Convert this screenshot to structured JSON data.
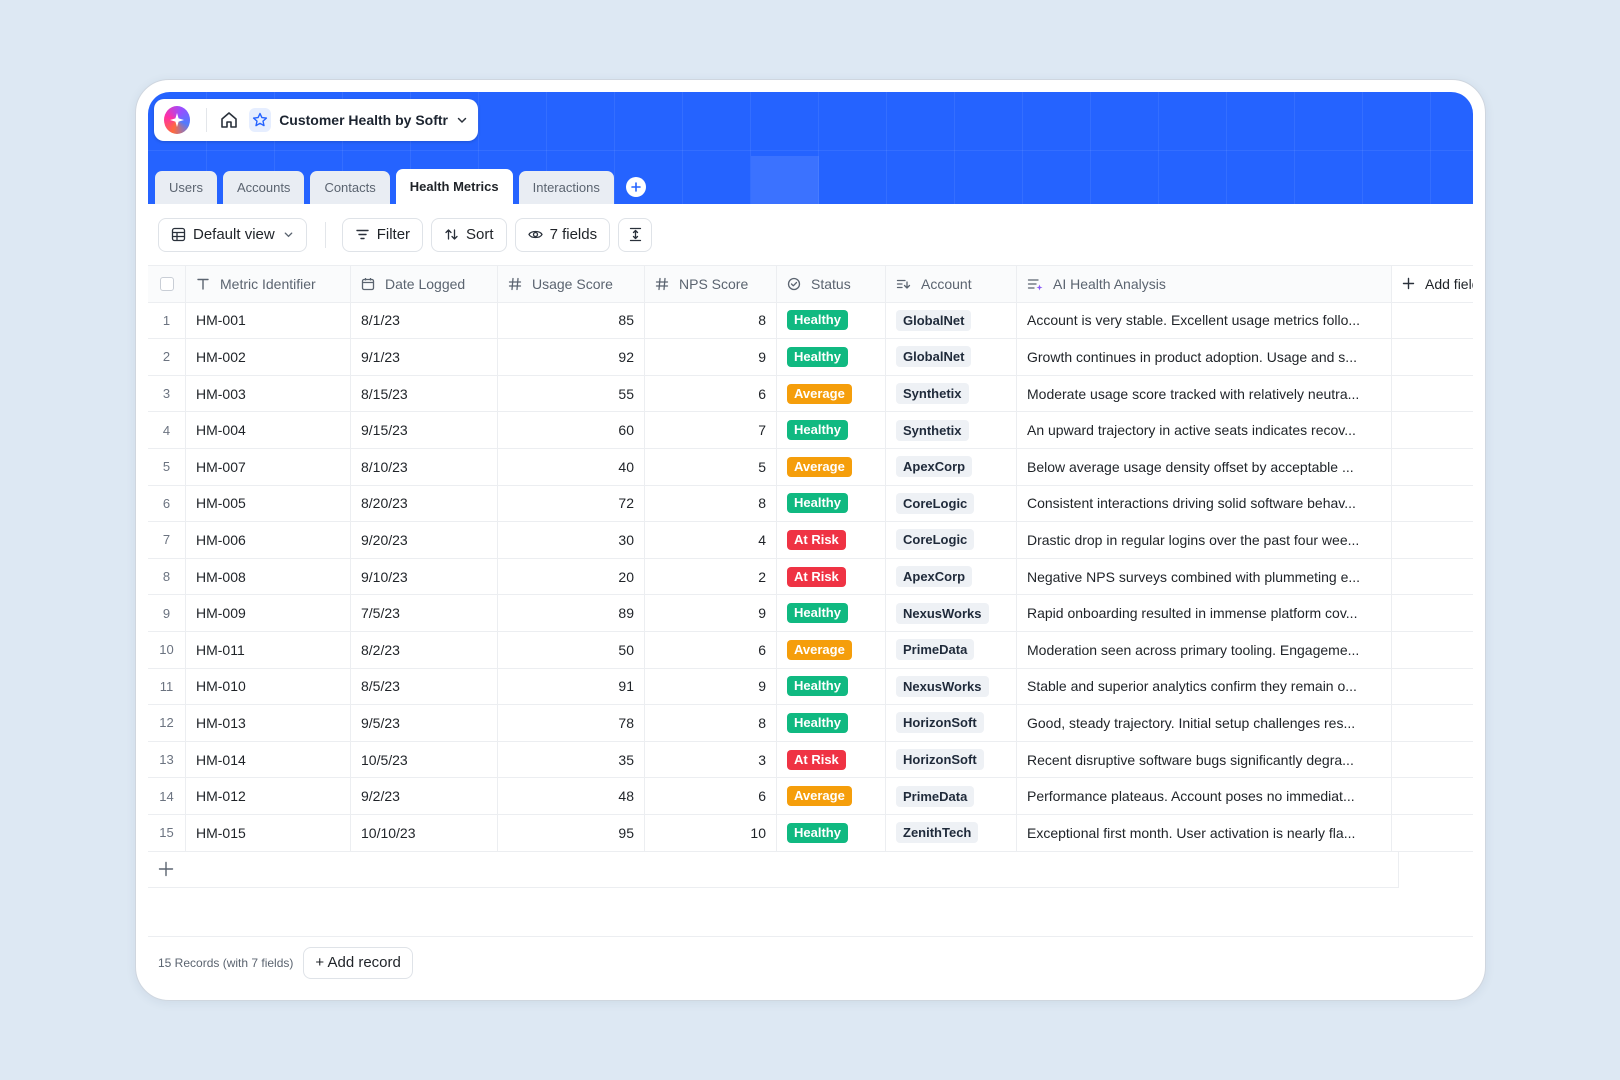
{
  "app": {
    "title": "Customer Health by Softr"
  },
  "tabs": [
    {
      "label": "Users",
      "active": false
    },
    {
      "label": "Accounts",
      "active": false
    },
    {
      "label": "Contacts",
      "active": false
    },
    {
      "label": "Health Metrics",
      "active": true
    },
    {
      "label": "Interactions",
      "active": false
    }
  ],
  "toolbar": {
    "view_label": "Default view",
    "filter_label": "Filter",
    "sort_label": "Sort",
    "fields_label": "7 fields"
  },
  "columns": {
    "metric": "Metric Identifier",
    "date": "Date Logged",
    "usage": "Usage Score",
    "nps": "NPS Score",
    "status": "Status",
    "account": "Account",
    "analysis": "AI Health Analysis",
    "add_field": "Add field"
  },
  "status_colors": {
    "Healthy": "#10b981",
    "Average": "#f59e0b",
    "At Risk": "#ef3344"
  },
  "rows": [
    {
      "n": "1",
      "id": "HM-001",
      "date": "8/1/23",
      "usage": "85",
      "nps": "8",
      "status": "Healthy",
      "account": "GlobalNet",
      "analysis": "Account is very stable. Excellent usage metrics follo..."
    },
    {
      "n": "2",
      "id": "HM-002",
      "date": "9/1/23",
      "usage": "92",
      "nps": "9",
      "status": "Healthy",
      "account": "GlobalNet",
      "analysis": "Growth continues in product adoption. Usage and s..."
    },
    {
      "n": "3",
      "id": "HM-003",
      "date": "8/15/23",
      "usage": "55",
      "nps": "6",
      "status": "Average",
      "account": "Synthetix",
      "analysis": "Moderate usage score tracked with relatively neutra..."
    },
    {
      "n": "4",
      "id": "HM-004",
      "date": "9/15/23",
      "usage": "60",
      "nps": "7",
      "status": "Healthy",
      "account": "Synthetix",
      "analysis": "An upward trajectory in active seats indicates recov..."
    },
    {
      "n": "5",
      "id": "HM-007",
      "date": "8/10/23",
      "usage": "40",
      "nps": "5",
      "status": "Average",
      "account": "ApexCorp",
      "analysis": "Below average usage density offset by acceptable ..."
    },
    {
      "n": "6",
      "id": "HM-005",
      "date": "8/20/23",
      "usage": "72",
      "nps": "8",
      "status": "Healthy",
      "account": "CoreLogic",
      "analysis": "Consistent interactions driving solid software behav..."
    },
    {
      "n": "7",
      "id": "HM-006",
      "date": "9/20/23",
      "usage": "30",
      "nps": "4",
      "status": "At Risk",
      "account": "CoreLogic",
      "analysis": "Drastic drop in regular logins over the past four wee..."
    },
    {
      "n": "8",
      "id": "HM-008",
      "date": "9/10/23",
      "usage": "20",
      "nps": "2",
      "status": "At Risk",
      "account": "ApexCorp",
      "analysis": "Negative NPS surveys combined with plummeting e..."
    },
    {
      "n": "9",
      "id": "HM-009",
      "date": "7/5/23",
      "usage": "89",
      "nps": "9",
      "status": "Healthy",
      "account": "NexusWorks",
      "analysis": "Rapid onboarding resulted in immense platform cov..."
    },
    {
      "n": "10",
      "id": "HM-011",
      "date": "8/2/23",
      "usage": "50",
      "nps": "6",
      "status": "Average",
      "account": "PrimeData",
      "analysis": "Moderation seen across primary tooling. Engageme..."
    },
    {
      "n": "11",
      "id": "HM-010",
      "date": "8/5/23",
      "usage": "91",
      "nps": "9",
      "status": "Healthy",
      "account": "NexusWorks",
      "analysis": "Stable and superior analytics confirm they remain o..."
    },
    {
      "n": "12",
      "id": "HM-013",
      "date": "9/5/23",
      "usage": "78",
      "nps": "8",
      "status": "Healthy",
      "account": "HorizonSoft",
      "analysis": "Good, steady trajectory. Initial setup challenges res..."
    },
    {
      "n": "13",
      "id": "HM-014",
      "date": "10/5/23",
      "usage": "35",
      "nps": "3",
      "status": "At Risk",
      "account": "HorizonSoft",
      "analysis": "Recent disruptive software bugs significantly degra..."
    },
    {
      "n": "14",
      "id": "HM-012",
      "date": "9/2/23",
      "usage": "48",
      "nps": "6",
      "status": "Average",
      "account": "PrimeData",
      "analysis": "Performance plateaus. Account poses no immediat..."
    },
    {
      "n": "15",
      "id": "HM-015",
      "date": "10/10/23",
      "usage": "95",
      "nps": "10",
      "status": "Healthy",
      "account": "ZenithTech",
      "analysis": "Exceptional first month. User activation is nearly fla..."
    }
  ],
  "footer": {
    "count_label": "15 Records (with 7 fields)",
    "add_record_label": "+ Add record"
  }
}
